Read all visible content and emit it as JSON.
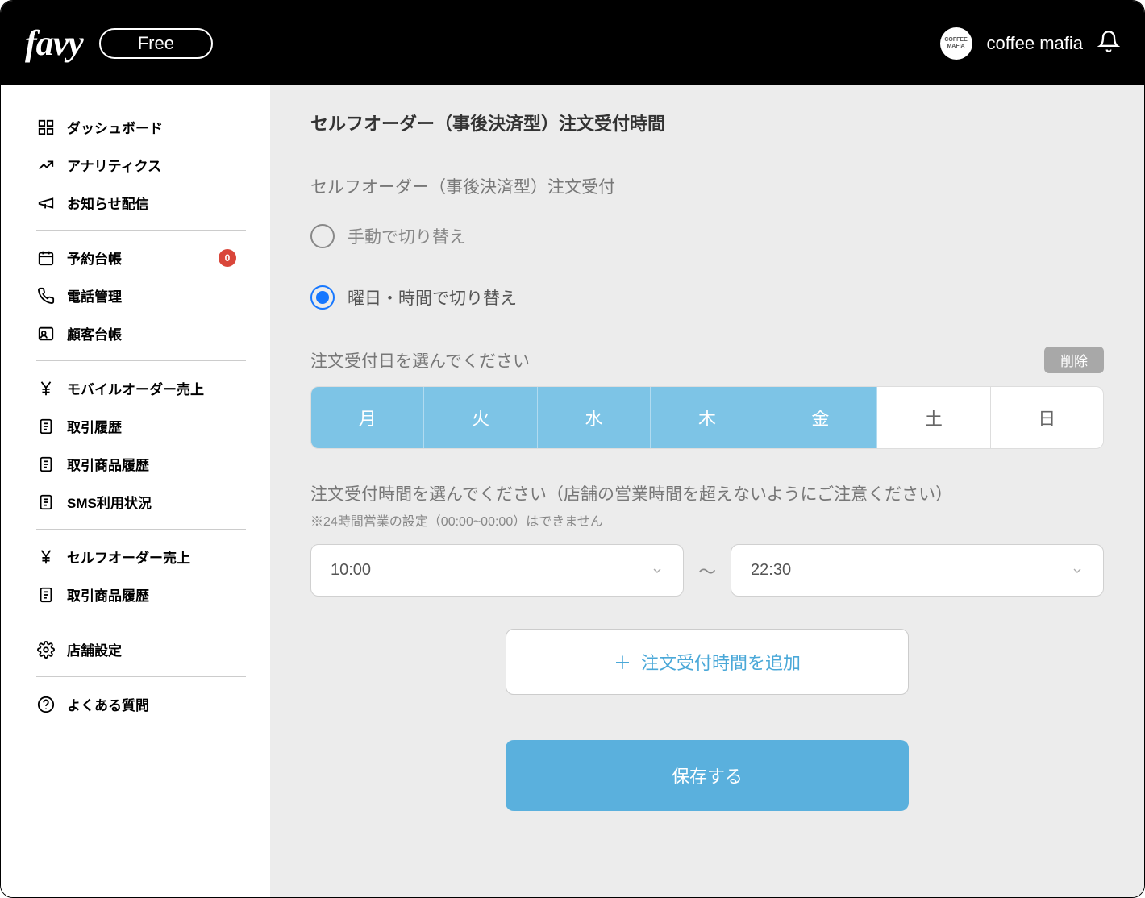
{
  "header": {
    "logo": "favy",
    "plan": "Free",
    "avatar_text": "COFFEE MAFIA",
    "username": "coffee mafia"
  },
  "sidebar": {
    "groups": [
      {
        "items": [
          {
            "icon": "home-icon",
            "label": "ダッシュボード"
          },
          {
            "icon": "analytics-icon",
            "label": "アナリティクス"
          },
          {
            "icon": "megaphone-icon",
            "label": "お知らせ配信"
          }
        ]
      },
      {
        "items": [
          {
            "icon": "calendar-icon",
            "label": "予約台帳",
            "badge": "0"
          },
          {
            "icon": "phone-icon",
            "label": "電話管理"
          },
          {
            "icon": "contact-icon",
            "label": "顧客台帳"
          }
        ]
      },
      {
        "items": [
          {
            "icon": "yen-icon",
            "label": "モバイルオーダー売上"
          },
          {
            "icon": "document-icon",
            "label": "取引履歴"
          },
          {
            "icon": "document-icon",
            "label": "取引商品履歴"
          },
          {
            "icon": "document-icon",
            "label": "SMS利用状況"
          }
        ]
      },
      {
        "items": [
          {
            "icon": "yen-icon",
            "label": "セルフオーダー売上"
          },
          {
            "icon": "document-icon",
            "label": "取引商品履歴"
          }
        ]
      },
      {
        "items": [
          {
            "icon": "gear-icon",
            "label": "店舗設定"
          }
        ]
      },
      {
        "items": [
          {
            "icon": "question-icon",
            "label": "よくある質問"
          }
        ]
      }
    ]
  },
  "main": {
    "page_title": "セルフオーダー（事後決済型）注文受付時間",
    "section_title": "セルフオーダー（事後決済型）注文受付",
    "radio_manual": "手動で切り替え",
    "radio_schedule": "曜日・時間で切り替え",
    "days_header": "注文受付日を選んでください",
    "delete_label": "削除",
    "days": [
      {
        "label": "月",
        "on": true
      },
      {
        "label": "火",
        "on": true
      },
      {
        "label": "水",
        "on": true
      },
      {
        "label": "木",
        "on": true
      },
      {
        "label": "金",
        "on": true
      },
      {
        "label": "土",
        "on": false
      },
      {
        "label": "日",
        "on": false
      }
    ],
    "time_header": "注文受付時間を選んでください（店舗の営業時間を超えないようにご注意ください）",
    "time_note": "※24時間営業の設定（00:00~00:00）はできません",
    "time_from": "10:00",
    "time_sep": "〜",
    "time_to": "22:30",
    "add_label": "注文受付時間を追加",
    "save_label": "保存する"
  }
}
